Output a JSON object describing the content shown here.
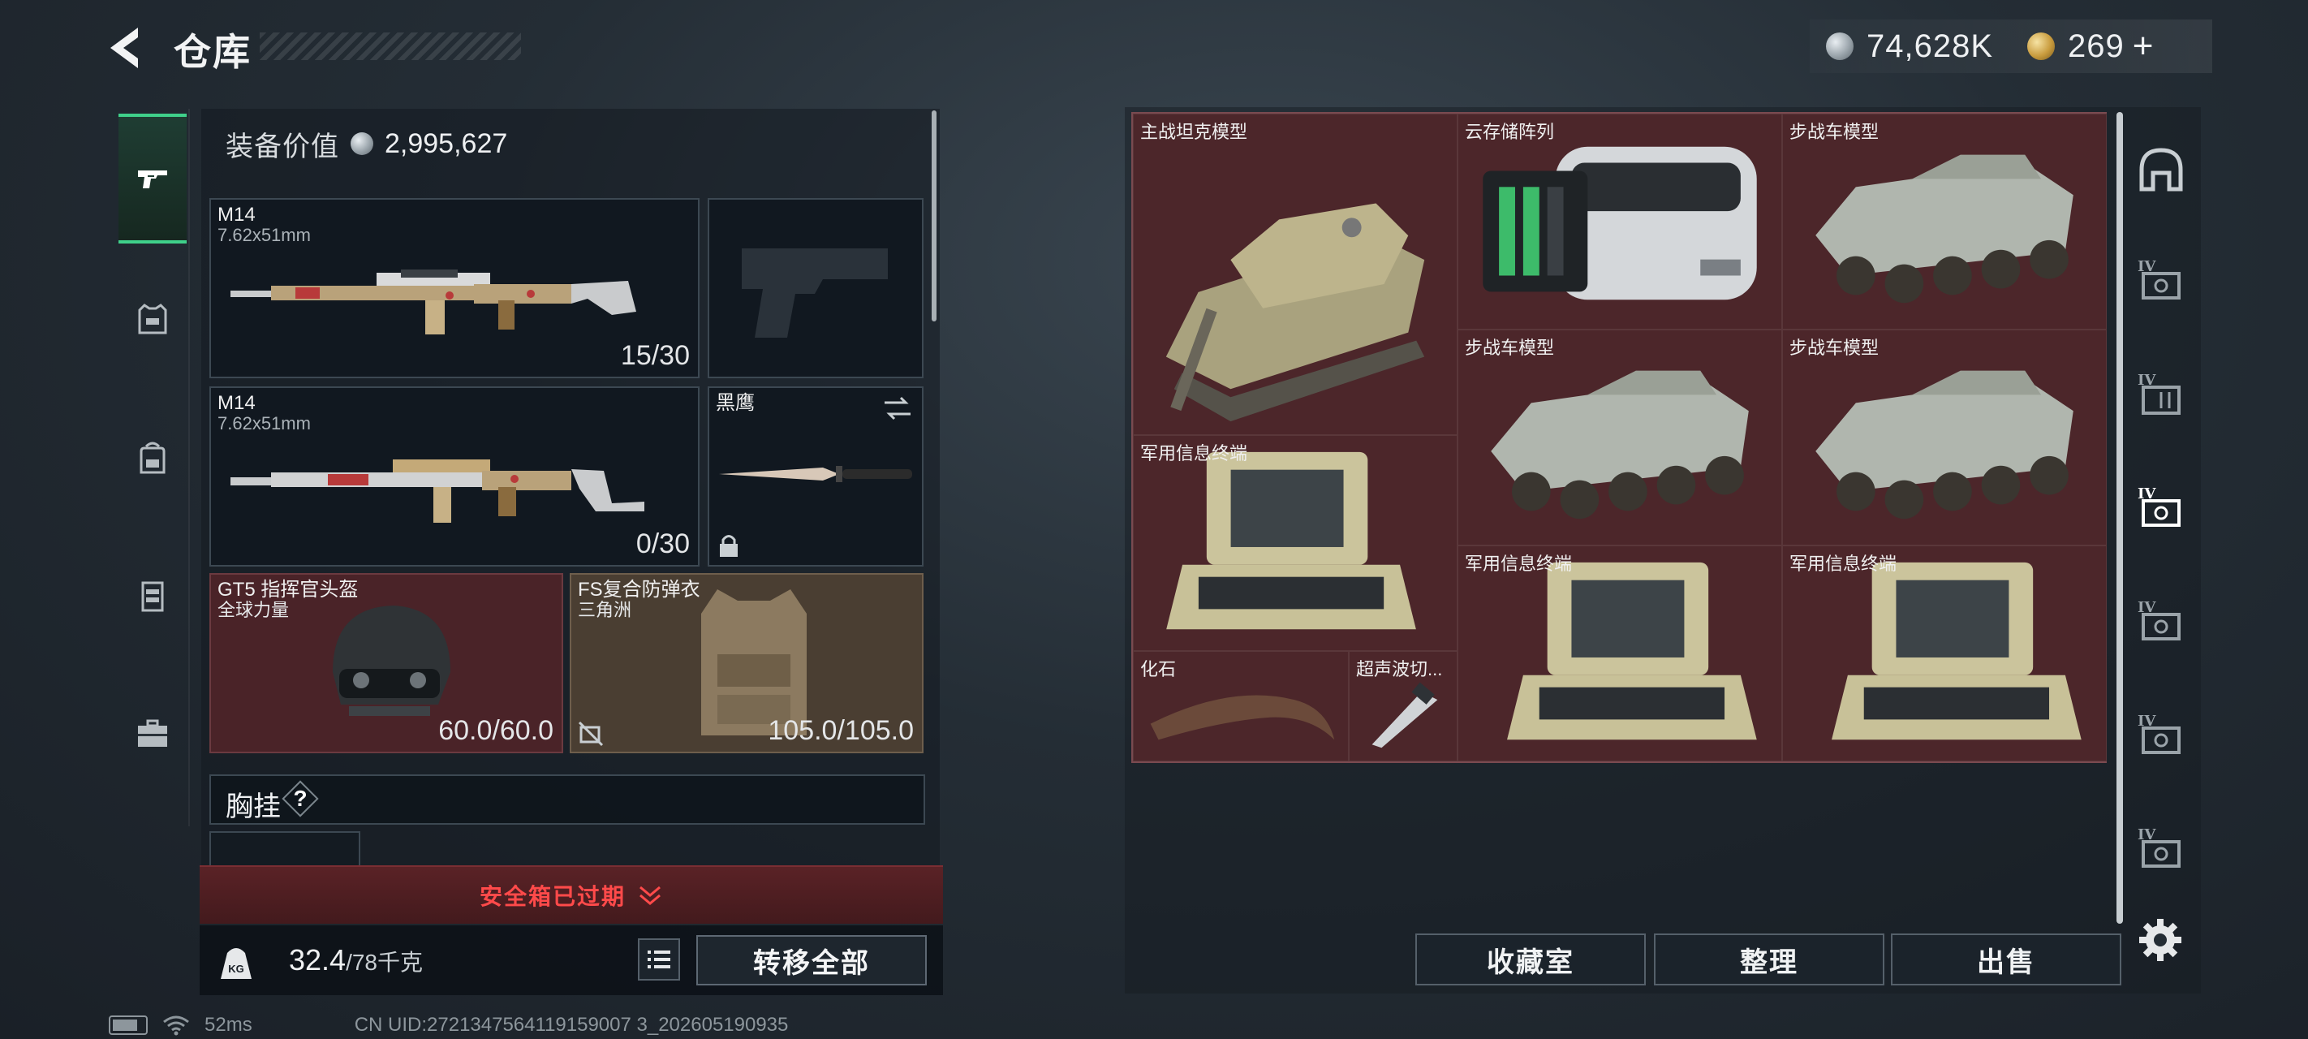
{
  "header": {
    "title": "仓库",
    "currency": {
      "silver": "74,628K",
      "gold": "269"
    }
  },
  "equipment": {
    "value_label": "装备价值",
    "value": "2,995,627",
    "primary_weapon_1": {
      "name": "M14",
      "caliber": "7.62x51mm",
      "ammo": "15/30"
    },
    "primary_weapon_2": {
      "name": "M14",
      "caliber": "7.62x51mm",
      "ammo": "0/30"
    },
    "melee": {
      "name": "黑鹰"
    },
    "helmet": {
      "name": "GT5 指挥官头盔",
      "sub": "全球力量",
      "durability": "60.0/60.0"
    },
    "armor": {
      "name": "FS复合防弹衣",
      "sub": "三角洲",
      "durability": "105.0/105.0"
    },
    "chest_rig_label": "胸挂",
    "chest_rig_help": "?",
    "safe_box_text": "安全箱已过期",
    "weight_current": "32.4",
    "weight_max": "/78千克",
    "transfer_all": "转移全部"
  },
  "status_bar": {
    "ping": "52ms",
    "uid": "CN UID:2721347564119159007 3_202605190935"
  },
  "storage": {
    "items": [
      {
        "name": "主战坦克模型",
        "icon": "tank-model"
      },
      {
        "name": "云存储阵列",
        "icon": "cloud-storage-array"
      },
      {
        "name": "步战车模型",
        "icon": "ifv-model"
      },
      {
        "name": "步战车模型",
        "icon": "ifv-model"
      },
      {
        "name": "步战车模型",
        "icon": "ifv-model"
      },
      {
        "name": "军用信息终端",
        "icon": "military-terminal"
      },
      {
        "name": "军用信息终端",
        "icon": "military-terminal"
      },
      {
        "name": "军用信息终端",
        "icon": "military-terminal"
      },
      {
        "name": "化石",
        "icon": "fossil-claw"
      },
      {
        "name": "超声波切...",
        "icon": "ultrasonic-cutter"
      }
    ],
    "buttons": {
      "collection": "收藏室",
      "organize": "整理",
      "sell": "出售"
    }
  },
  "right_nav": {
    "tiers": [
      "IV",
      "IV",
      "IV",
      "IV",
      "IV",
      "IV"
    ]
  },
  "colors": {
    "accent_green": "#3fd08a",
    "cell_red": "#4c262a",
    "alert_red": "#ff4a4a"
  }
}
